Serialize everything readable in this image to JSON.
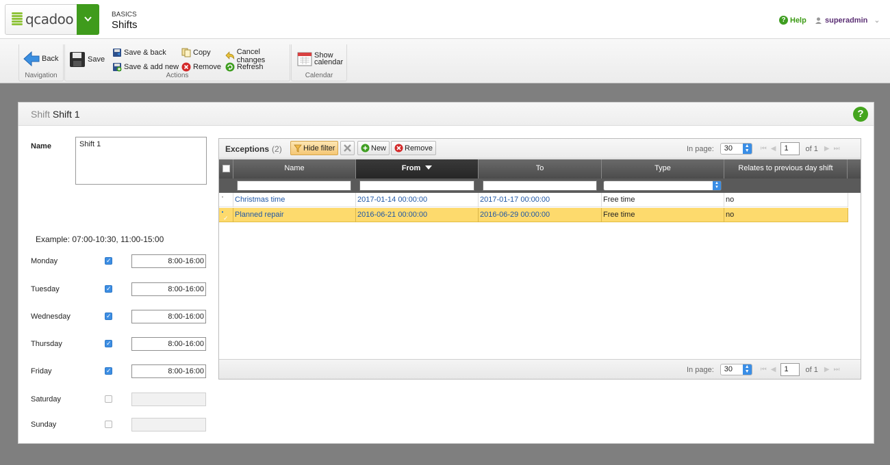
{
  "header": {
    "logo_text": "qcadoo",
    "section": "BASICS",
    "title": "Shifts",
    "help_label": "Help",
    "user": "superadmin"
  },
  "ribbon": {
    "back": "Back",
    "save": "Save",
    "save_back": "Save & back",
    "save_add_new": "Save & add new",
    "copy": "Copy",
    "remove": "Remove",
    "cancel_changes": "Cancel changes",
    "refresh": "Refresh",
    "show_calendar_1": "Show",
    "show_calendar_2": "calendar",
    "group_navigation": "Navigation",
    "group_actions": "Actions",
    "group_calendar": "Calendar"
  },
  "form": {
    "title_prefix": "Shift",
    "title_name": "Shift 1",
    "name_label": "Name",
    "name_value": "Shift 1",
    "example": "Example: 07:00-10:30, 11:00-15:00",
    "days": [
      {
        "label": "Monday",
        "checked": true,
        "hours": "8:00-16:00"
      },
      {
        "label": "Tuesday",
        "checked": true,
        "hours": "8:00-16:00"
      },
      {
        "label": "Wednesday",
        "checked": true,
        "hours": "8:00-16:00"
      },
      {
        "label": "Thursday",
        "checked": true,
        "hours": "8:00-16:00"
      },
      {
        "label": "Friday",
        "checked": true,
        "hours": "8:00-16:00"
      },
      {
        "label": "Saturday",
        "checked": false,
        "hours": ""
      },
      {
        "label": "Sunday",
        "checked": false,
        "hours": ""
      }
    ]
  },
  "grid": {
    "caption": "Exceptions",
    "count": "(2)",
    "hide_filter": "Hide filter",
    "new": "New",
    "remove": "Remove",
    "in_page_label": "In page:",
    "page_size": "30",
    "page": "1",
    "of_label": "of 1",
    "columns": [
      "Name",
      "From",
      "To",
      "Type",
      "Relates to previous day shift"
    ],
    "rows": [
      {
        "selected": false,
        "name": "Christmas time",
        "from": "2017-01-14 00:00:00",
        "to": "2017-01-17 00:00:00",
        "type": "Free time",
        "relates": "no"
      },
      {
        "selected": true,
        "name": "Planned repair",
        "from": "2016-06-21 00:00:00",
        "to": "2016-06-29 00:00:00",
        "type": "Free time",
        "relates": "no"
      }
    ]
  },
  "colors": {
    "accent_green": "#3f9b1c",
    "selected_row": "#fdda6d",
    "link_blue": "#1f57a6",
    "checkbox_blue": "#3d8ee3"
  }
}
